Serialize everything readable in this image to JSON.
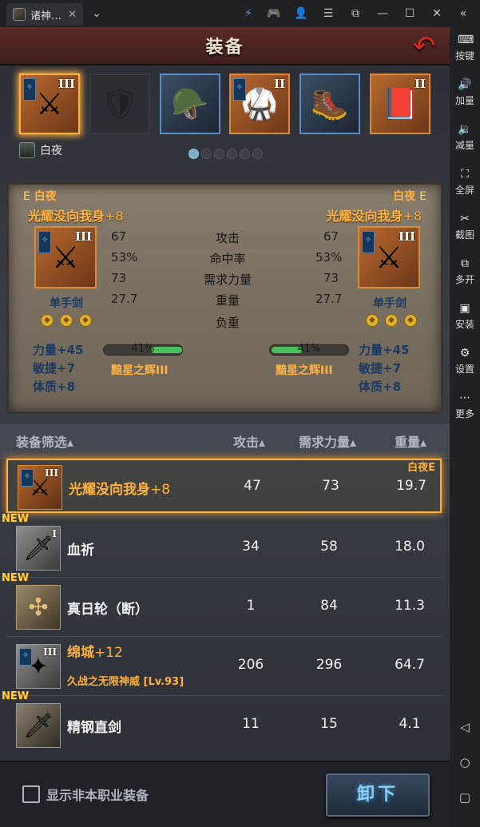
{
  "window": {
    "tab_title": "诸神…",
    "tab_close": "✕",
    "tab_dropdown": "⌄",
    "controls": [
      "⚡",
      "🎮",
      "👤",
      "☰",
      "⧉",
      "—",
      "☐",
      "✕",
      "«"
    ]
  },
  "sidebar": {
    "items": [
      {
        "label": "按键",
        "icon": "keyboard-icon",
        "glyph": "⌨"
      },
      {
        "label": "加量",
        "icon": "volume-up-icon",
        "glyph": "🔊"
      },
      {
        "label": "减量",
        "icon": "volume-down-icon",
        "glyph": "🔉"
      },
      {
        "label": "全屏",
        "icon": "fullscreen-icon",
        "glyph": "⛶"
      },
      {
        "label": "截图",
        "icon": "scissors-icon",
        "glyph": "✂"
      },
      {
        "label": "多开",
        "icon": "multi-instance-icon",
        "glyph": "⧉"
      },
      {
        "label": "安装",
        "icon": "apk-install-icon",
        "glyph": "▣"
      },
      {
        "label": "设置",
        "icon": "gear-icon",
        "glyph": "⚙"
      },
      {
        "label": "更多",
        "icon": "more-icon",
        "glyph": "⋯"
      }
    ],
    "nav": [
      "◁",
      "○",
      "▢"
    ]
  },
  "header": {
    "title": "装备",
    "back": "↶"
  },
  "slots": [
    {
      "roman": "III",
      "art": "⚔",
      "style": "orange",
      "selected": true
    },
    {
      "roman": "",
      "art": "🛡",
      "style": "empty"
    },
    {
      "roman": "",
      "art": "🪖",
      "style": "blue"
    },
    {
      "roman": "II",
      "art": "🥋",
      "style": "orange"
    },
    {
      "roman": "",
      "art": "🥾",
      "style": "blue"
    },
    {
      "roman": "II",
      "art": "📕",
      "style": "orange"
    }
  ],
  "owner": {
    "name": "白夜"
  },
  "compare": {
    "left": {
      "owner": "白夜",
      "grade": "E",
      "name": "光耀没向我身",
      "plus": "+8",
      "roman": "III",
      "type": "单手剑",
      "stats": [
        "67",
        "53%",
        "73",
        "27.7"
      ],
      "load": "41%",
      "load_fill": 0.41,
      "set": "黯星之辉III",
      "bonuses": [
        "力量+45",
        "敏捷+7",
        "体质+8"
      ]
    },
    "right": {
      "owner": "白夜",
      "grade": "E",
      "name": "光耀没向我身",
      "plus": "+8",
      "roman": "III",
      "type": "单手剑",
      "stats": [
        "67",
        "53%",
        "73",
        "27.7"
      ],
      "load": "41%",
      "load_fill": 0.41,
      "set": "黯星之辉III",
      "bonuses": [
        "力量+45",
        "敏捷+7",
        "体质+8"
      ]
    },
    "labels": [
      "攻击",
      "命中率",
      "需求力量",
      "重量",
      "负重"
    ]
  },
  "list": {
    "headers": {
      "filter": "装备筛选▴",
      "attack": "攻击▴",
      "strength": "需求力量▴",
      "weight": "重量▴"
    },
    "rows": [
      {
        "name": "光耀没向我身",
        "plus": "+8",
        "attack": "47",
        "strength": "73",
        "weight": "19.7",
        "roman": "III",
        "owner": "白夜E",
        "new": "",
        "art": "⚔",
        "selected": true
      },
      {
        "name": "血祈",
        "plus": "",
        "attack": "34",
        "strength": "58",
        "weight": "18.0",
        "roman": "I",
        "owner": "",
        "new": "NEW",
        "art": "🗡"
      },
      {
        "name": "真日轮（断）",
        "plus": "",
        "attack": "1",
        "strength": "84",
        "weight": "11.3",
        "roman": "",
        "owner": "",
        "new": "NEW",
        "art": "✣"
      },
      {
        "name": "绵城",
        "plus": "+12",
        "attack": "206",
        "strength": "296",
        "weight": "64.7",
        "roman": "III",
        "owner": "",
        "new": "",
        "art": "✦",
        "sub": "久战之无限神威 [Lv.93]"
      },
      {
        "name": "精钢直剑",
        "plus": "",
        "attack": "11",
        "strength": "15",
        "weight": "4.1",
        "roman": "",
        "owner": "",
        "new": "NEW",
        "art": "🗡"
      }
    ]
  },
  "footer": {
    "checkbox": "显示非本职业装备",
    "button": "卸下"
  }
}
